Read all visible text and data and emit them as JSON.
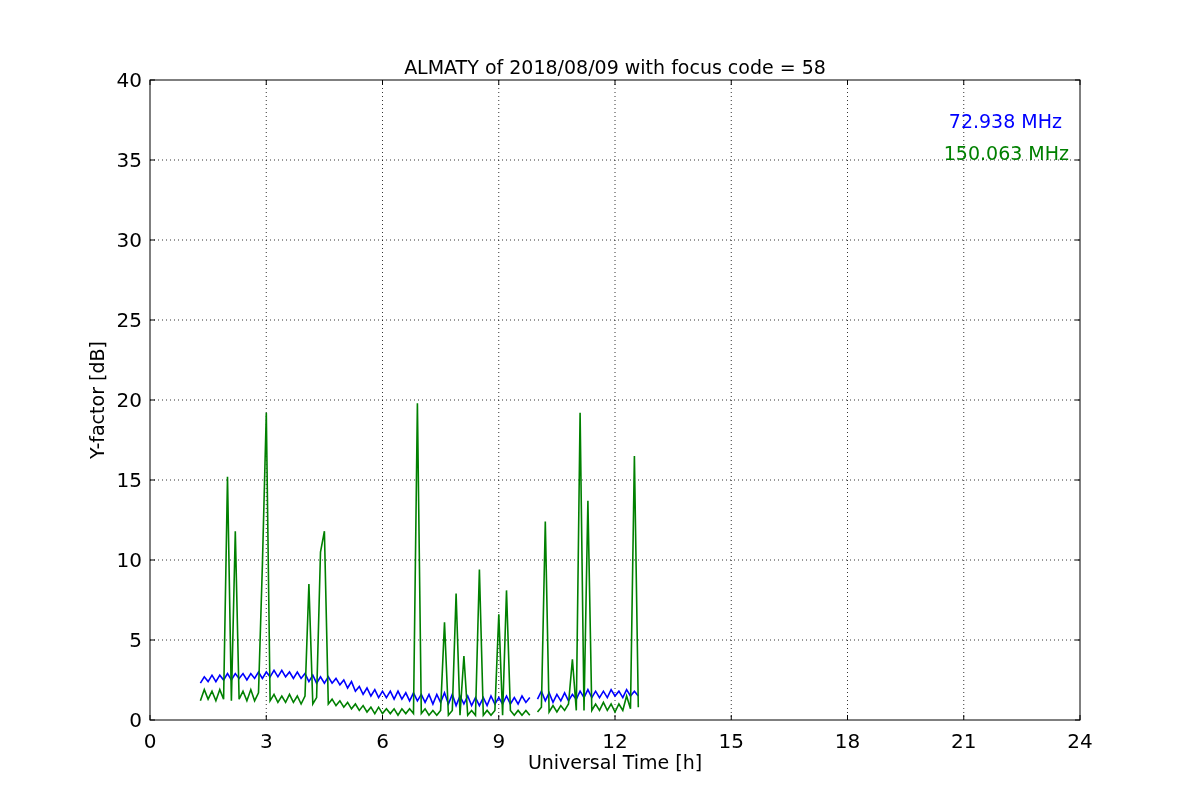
{
  "figure": {
    "chart_data": {
      "type": "line",
      "title": "ALMATY of 2018/08/09 with focus code = 58",
      "xlabel": "Universal Time [h]",
      "ylabel": "Y-factor [dB]",
      "x": [
        1.3,
        1.4,
        1.5,
        1.6,
        1.7,
        1.8,
        1.9,
        2.0,
        2.1,
        2.2,
        2.3,
        2.4,
        2.5,
        2.6,
        2.7,
        2.8,
        2.9,
        3.0,
        3.1,
        3.2,
        3.3,
        3.4,
        3.5,
        3.6,
        3.7,
        3.8,
        3.9,
        4.0,
        4.1,
        4.2,
        4.3,
        4.4,
        4.5,
        4.6,
        4.7,
        4.8,
        4.9,
        5.0,
        5.1,
        5.2,
        5.3,
        5.4,
        5.5,
        5.6,
        5.7,
        5.8,
        5.9,
        6.0,
        6.1,
        6.2,
        6.3,
        6.4,
        6.5,
        6.6,
        6.7,
        6.8,
        6.9,
        7.0,
        7.1,
        7.2,
        7.3,
        7.4,
        7.5,
        7.6,
        7.7,
        7.8,
        7.9,
        8.0,
        8.1,
        8.2,
        8.3,
        8.4,
        8.5,
        8.6,
        8.7,
        8.8,
        8.9,
        9.0,
        9.1,
        9.2,
        9.3,
        9.4,
        9.5,
        9.6,
        9.7,
        9.8,
        9.9,
        10.0,
        10.1,
        10.2,
        10.3,
        10.4,
        10.5,
        10.6,
        10.7,
        10.8,
        10.9,
        11.0,
        11.1,
        11.2,
        11.3,
        11.4,
        11.5,
        11.6,
        11.7,
        11.8,
        11.9,
        12.0,
        12.1,
        12.2,
        12.3,
        12.4,
        12.5,
        12.6
      ],
      "series": [
        {
          "name": "72.938 MHz",
          "color": "#0000ff",
          "values": [
            2.3,
            2.7,
            2.4,
            2.8,
            2.4,
            2.8,
            2.5,
            2.9,
            2.5,
            2.9,
            2.6,
            2.9,
            2.5,
            2.9,
            2.6,
            3.0,
            2.6,
            3.0,
            2.7,
            3.1,
            2.7,
            3.1,
            2.7,
            3.0,
            2.6,
            3.0,
            2.6,
            2.9,
            2.4,
            2.8,
            2.3,
            2.7,
            2.3,
            2.7,
            2.3,
            2.6,
            2.2,
            2.5,
            2.0,
            2.4,
            1.8,
            2.1,
            1.6,
            2.0,
            1.5,
            1.9,
            1.4,
            1.8,
            1.4,
            1.8,
            1.3,
            1.8,
            1.3,
            1.7,
            1.2,
            1.7,
            1.2,
            1.6,
            1.1,
            1.6,
            1.0,
            1.6,
            1.1,
            1.7,
            1.0,
            1.6,
            0.9,
            1.5,
            1.0,
            1.5,
            0.9,
            1.4,
            0.9,
            1.4,
            0.9,
            1.5,
            1.0,
            1.4,
            1.0,
            1.5,
            1.0,
            1.4,
            1.0,
            1.5,
            1.1,
            1.4,
            null,
            1.3,
            1.8,
            1.2,
            1.7,
            1.1,
            1.6,
            1.2,
            1.7,
            1.2,
            1.6,
            1.3,
            1.8,
            1.4,
            1.9,
            1.4,
            1.8,
            1.4,
            1.8,
            1.4,
            1.9,
            1.5,
            1.8,
            1.4,
            1.9,
            1.5,
            1.8,
            1.5
          ]
        },
        {
          "name": "150.063 MHz",
          "color": "#008000",
          "values": [
            1.2,
            1.9,
            1.3,
            1.8,
            1.2,
            1.9,
            1.3,
            15.2,
            1.2,
            11.8,
            1.3,
            1.8,
            1.2,
            1.9,
            1.2,
            1.7,
            9.7,
            19.2,
            1.2,
            1.6,
            1.1,
            1.5,
            1.1,
            1.6,
            1.1,
            1.5,
            1.0,
            1.5,
            8.5,
            1.0,
            1.4,
            10.5,
            11.8,
            1.0,
            1.3,
            0.9,
            1.2,
            0.8,
            1.1,
            0.7,
            1.0,
            0.6,
            0.9,
            0.5,
            0.8,
            0.4,
            0.8,
            0.4,
            0.7,
            0.4,
            0.7,
            0.3,
            0.7,
            0.4,
            0.7,
            0.4,
            19.8,
            0.4,
            0.7,
            0.3,
            0.6,
            0.3,
            0.6,
            6.1,
            0.3,
            0.6,
            7.9,
            0.3,
            4.0,
            0.3,
            0.6,
            0.3,
            9.4,
            0.3,
            0.6,
            0.3,
            0.6,
            6.6,
            0.3,
            8.1,
            0.6,
            0.3,
            0.6,
            0.3,
            0.6,
            0.3,
            null,
            0.5,
            0.8,
            12.4,
            0.5,
            0.9,
            0.5,
            0.9,
            0.6,
            1.0,
            3.8,
            0.6,
            19.2,
            0.6,
            13.7,
            0.6,
            1.0,
            0.6,
            1.1,
            0.6,
            1.0,
            0.5,
            1.0,
            0.6,
            1.5,
            0.7,
            16.5,
            0.8
          ]
        }
      ],
      "xlim": [
        0,
        24
      ],
      "ylim": [
        0,
        40
      ],
      "xticks": [
        0,
        3,
        6,
        9,
        12,
        15,
        18,
        21,
        24
      ],
      "yticks": [
        0,
        5,
        10,
        15,
        20,
        25,
        30,
        35,
        40
      ],
      "grid": true
    }
  }
}
